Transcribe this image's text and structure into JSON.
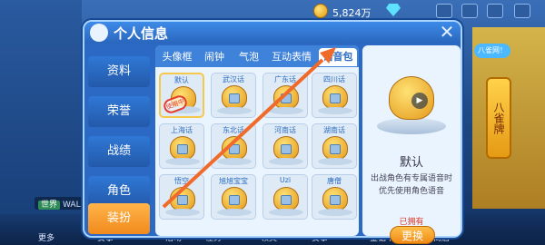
{
  "topbar": {
    "coin_amount": "5,824万"
  },
  "panel": {
    "title": "个人信息",
    "close_glyph": "✕"
  },
  "sidebar": {
    "items": [
      {
        "label": "资料"
      },
      {
        "label": "荣誉"
      },
      {
        "label": "战绩"
      },
      {
        "label": "角色"
      },
      {
        "label": "装扮"
      }
    ]
  },
  "tabs": [
    {
      "label": "头像框"
    },
    {
      "label": "闹钟"
    },
    {
      "label": "气泡"
    },
    {
      "label": "互动表情"
    },
    {
      "label": "语音包"
    }
  ],
  "tab_info": "i",
  "voices": [
    {
      "name": "默认"
    },
    {
      "name": "武汉话"
    },
    {
      "name": "广东话"
    },
    {
      "name": "四川话"
    },
    {
      "name": "上海话"
    },
    {
      "name": "东北话"
    },
    {
      "name": "河南话"
    },
    {
      "name": "湖南话"
    },
    {
      "name": "悟空"
    },
    {
      "name": "旭旭宝宝"
    },
    {
      "name": "Uzi"
    },
    {
      "name": "唐僧"
    }
  ],
  "in_use_stamp": "使用中",
  "detail": {
    "name": "默认",
    "description": "出战角色有专属语音时优先使用角色语音",
    "owned": "已拥有",
    "change_button": "更换",
    "play_glyph": "▶"
  },
  "side_banner": {
    "bubble": "八雀网！",
    "banner": "八雀牌"
  },
  "chat": {
    "tag": "世界",
    "text": "WALK"
  },
  "bottom_nav": [
    {
      "label": "更多"
    },
    {
      "label": "赛事"
    },
    {
      "label": "活动"
    },
    {
      "label": "任务"
    },
    {
      "label": "领奖"
    },
    {
      "label": "赛事"
    },
    {
      "label": "金钻卡"
    },
    {
      "label": "商店"
    }
  ],
  "colors": {
    "panel": "#2c69c4",
    "active_tab": "#ffffff",
    "active_side": "#f18a1c",
    "arrow": "#f06a2a",
    "owned": "#e03a2a"
  }
}
